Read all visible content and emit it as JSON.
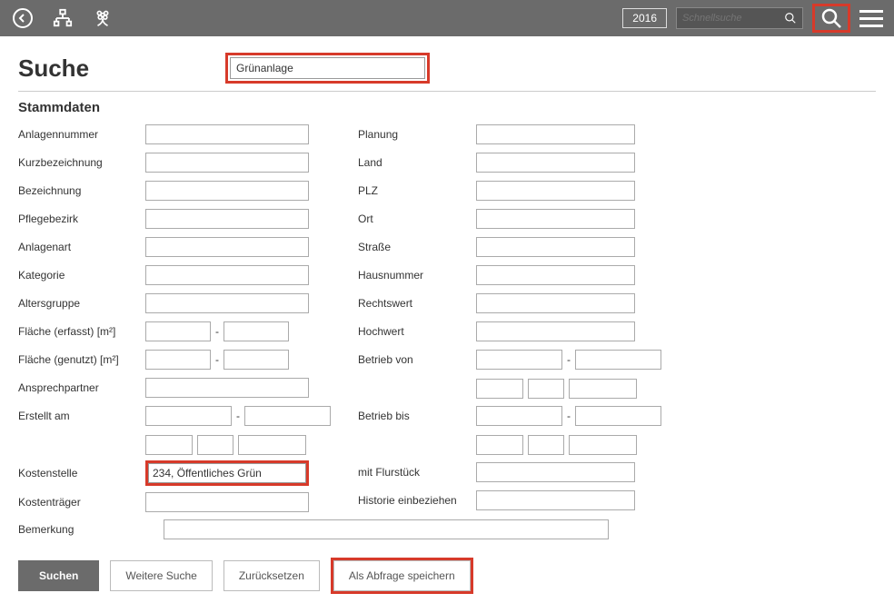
{
  "header": {
    "year": "2016",
    "quicksearch_placeholder": "Schnellsuche"
  },
  "page": {
    "title": "Suche",
    "main_dropdown": "Grünanlage"
  },
  "section": {
    "title": "Stammdaten"
  },
  "labels": {
    "anlagennummer": "Anlagennummer",
    "kurzbezeichnung": "Kurzbezeichnung",
    "bezeichnung": "Bezeichnung",
    "pflegebezirk": "Pflegebezirk",
    "anlagenart": "Anlagenart",
    "kategorie": "Kategorie",
    "altersgruppe": "Altersgruppe",
    "flaeche_erfasst": "Fläche (erfasst) [m²]",
    "flaeche_genutzt": "Fläche (genutzt) [m²]",
    "ansprechpartner": "Ansprechpartner",
    "erstellt_am": "Erstellt am",
    "kostenstelle": "Kostenstelle",
    "kostentraeger": "Kostenträger",
    "bemerkung": "Bemerkung",
    "planung": "Planung",
    "land": "Land",
    "plz": "PLZ",
    "ort": "Ort",
    "strasse": "Straße",
    "hausnummer": "Hausnummer",
    "rechtswert": "Rechtswert",
    "hochwert": "Hochwert",
    "betrieb_von": "Betrieb von",
    "betrieb_bis": "Betrieb bis",
    "mit_flurstueck": "mit Flurstück",
    "historie": "Historie einbeziehen"
  },
  "values": {
    "kostenstelle": "234, Öffentliches Grün"
  },
  "range_separator": "-",
  "buttons": {
    "suchen": "Suchen",
    "weitere_suche": "Weitere Suche",
    "zuruecksetzen": "Zurücksetzen",
    "als_abfrage_speichern": "Als Abfrage speichern"
  }
}
